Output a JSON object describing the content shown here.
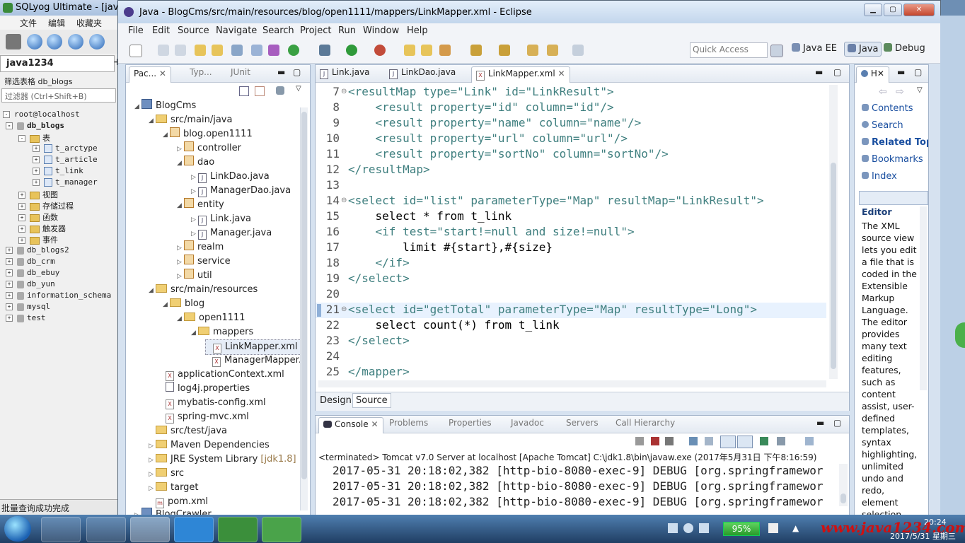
{
  "sqlyog": {
    "title": "SQLyog Ultimate - [java1",
    "menu": [
      "文件",
      "编辑",
      "收藏夹"
    ],
    "connection_tab": "java1234",
    "filter_label": "筛选表格 db_blogs",
    "filter_hint": "过滤器 (Ctrl+Shift+B)",
    "tree": [
      "root@localhost",
      "db_blogs",
      "表",
      "t_arctype",
      "t_article",
      "t_link",
      "t_manager",
      "视图",
      "存储过程",
      "函数",
      "触发器",
      "事件",
      "db_blogs2",
      "db_crm",
      "db_ebuy",
      "db_yun",
      "information_schema",
      "mysql",
      "test"
    ],
    "status": "批量查询成功完成"
  },
  "eclipse": {
    "title": "Java - BlogCms/src/main/resources/blog/open1111/mappers/LinkMapper.xml - Eclipse",
    "menu": [
      "File",
      "Edit",
      "Source",
      "Navigate",
      "Search",
      "Project",
      "Run",
      "Window",
      "Help"
    ],
    "quick_access": "Quick Access",
    "perspectives": [
      "Java EE",
      "Java",
      "Debug"
    ],
    "explorer_tabs": [
      "Pac...",
      "Typ...",
      "JUnit"
    ],
    "explorer_tree": [
      "BlogCms",
      "src/main/java",
      "blog.open1111",
      "controller",
      "dao",
      "LinkDao.java",
      "ManagerDao.java",
      "entity",
      "Link.java",
      "Manager.java",
      "realm",
      "service",
      "util",
      "src/main/resources",
      "blog",
      "open1111",
      "mappers",
      "LinkMapper.xml",
      "ManagerMapper.",
      "applicationContext.xml",
      "log4j.properties",
      "mybatis-config.xml",
      "spring-mvc.xml",
      "src/test/java",
      "Maven Dependencies",
      "JRE System Library",
      "[jdk1.8]",
      "src",
      "target",
      "pom.xml",
      "BlogCrawler"
    ],
    "editor_tabs": [
      "Link.java",
      "LinkDao.java",
      "LinkMapper.xml"
    ],
    "line_numbers": [
      "7",
      "8",
      "9",
      "10",
      "11",
      "12",
      "13",
      "14",
      "15",
      "16",
      "17",
      "18",
      "19",
      "20",
      "21",
      "22",
      "23",
      "24",
      "25"
    ],
    "code_lines": [
      "<resultMap type=\"Link\" id=\"LinkResult\">",
      "    <result property=\"id\" column=\"id\"/>",
      "    <result property=\"name\" column=\"name\"/>",
      "    <result property=\"url\" column=\"url\"/>",
      "    <result property=\"sortNo\" column=\"sortNo\"/>",
      "</resultMap>",
      "",
      "<select id=\"list\" parameterType=\"Map\" resultMap=\"LinkResult\">",
      "    select * from t_link",
      "    <if test=\"start!=null and size!=null\">",
      "        limit #{start},#{size}",
      "    </if>",
      "</select>",
      "",
      "<select id=\"getTotal\" parameterType=\"Map\" resultType=\"Long\">",
      "    select count(*) from t_link",
      "</select>",
      "",
      "</mapper>"
    ],
    "bottom_tabs": [
      "Design",
      "Source"
    ],
    "console_tabs": [
      "Console",
      "Problems",
      "Properties",
      "Javadoc",
      "Servers",
      "Call Hierarchy"
    ],
    "console_header": "<terminated> Tomcat v7.0 Server at localhost [Apache Tomcat] C:\\jdk1.8\\bin\\javaw.exe (2017年5月31日 下午8:16:59)",
    "console_lines": [
      "2017-05-31 20:18:02,382 [http-bio-8080-exec-9] DEBUG [org.springframewor",
      "2017-05-31 20:18:02,382 [http-bio-8080-exec-9] DEBUG [org.springframewor",
      "2017-05-31 20:18:02,382 [http-bio-8080-exec-9] DEBUG [org.springframewor"
    ],
    "help": {
      "tab": "H",
      "links": [
        "Contents",
        "Search",
        "Related Topi",
        "Bookmarks",
        "Index"
      ],
      "heading": "Editor",
      "body": [
        "The XML",
        "source view",
        "lets you edit",
        "a file that is",
        "coded in the",
        "Extensible",
        "Markup",
        "Language.",
        "The editor",
        "provides",
        "many text",
        "editing",
        "features,",
        "such as",
        "content",
        "assist, user-",
        "defined",
        "templates,",
        "syntax",
        "highlighting,",
        "unlimited",
        "undo and",
        "redo,",
        "element",
        "selection"
      ]
    }
  },
  "taskbar": {
    "battery": "95%",
    "watermark": "www.java1234.com",
    "date": "2017/5/31 星期三",
    "clock": "20:24"
  }
}
